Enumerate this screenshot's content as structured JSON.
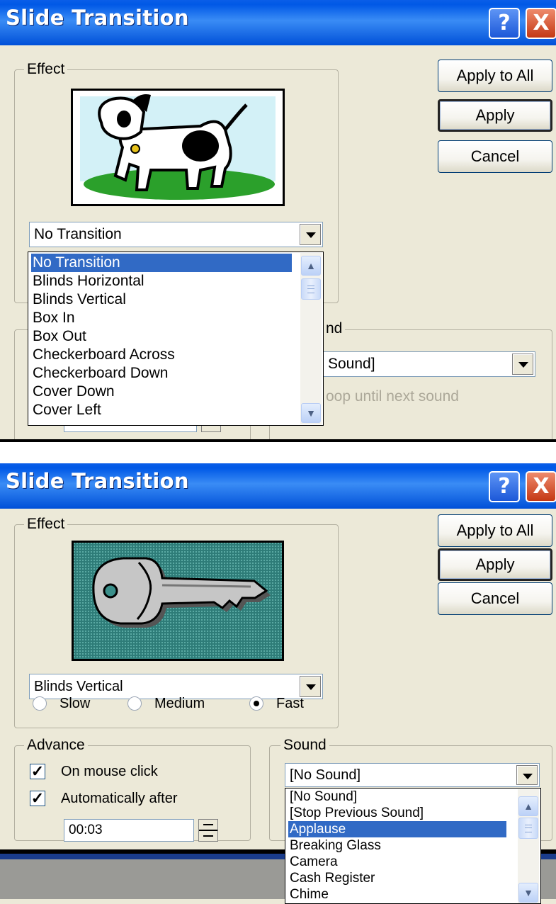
{
  "top_dialog": {
    "title": "Slide Transition",
    "help_label": "?",
    "close_label": "X",
    "effect_label": "Effect",
    "effect_value": "No Transition",
    "effect_options": [
      "No Transition",
      "Blinds Horizontal",
      "Blinds Vertical",
      "Box In",
      "Box Out",
      "Checkerboard Across",
      "Checkerboard Down",
      "Cover Down",
      "Cover Left"
    ],
    "selected_index": 0,
    "buttons": {
      "apply_to_all": "Apply to All",
      "apply": "Apply",
      "cancel": "Cancel"
    },
    "sound_label_partial": "nd",
    "sound_value_partial": "Sound]",
    "loop_partial": "oop until next sound",
    "preview_image": "dog-clipart"
  },
  "bottom_dialog": {
    "title": "Slide Transition",
    "help_label": "?",
    "close_label": "X",
    "effect_label": "Effect",
    "effect_value": "Blinds Vertical",
    "speed": {
      "slow": "Slow",
      "medium": "Medium",
      "fast": "Fast",
      "selected": "Fast"
    },
    "advance_label": "Advance",
    "on_mouse_click": "On mouse click",
    "on_mouse_click_checked": true,
    "automatically_after": "Automatically after",
    "automatically_after_checked": true,
    "time_value": "00:03",
    "sound_label": "Sound",
    "sound_value": "[No Sound]",
    "sound_options": [
      "[No Sound]",
      "[Stop Previous Sound]",
      "Applause",
      "Breaking Glass",
      "Camera",
      "Cash Register",
      "Chime"
    ],
    "selected_sound_index": 2,
    "buttons": {
      "apply_to_all": "Apply to All",
      "apply": "Apply",
      "cancel": "Cancel"
    },
    "preview_image": "key-clipart"
  },
  "colors": {
    "title_bar": "#0a5ee8",
    "selection": "#316ac5",
    "dialog_bg": "#ece9d8"
  }
}
